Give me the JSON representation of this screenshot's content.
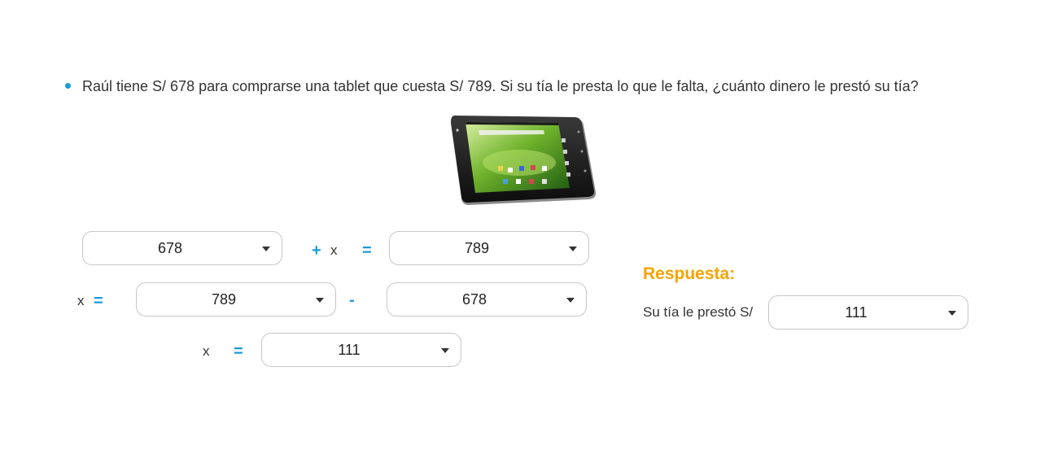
{
  "question": {
    "text": "Raúl tiene S/ 678 para comprarse una tablet que cuesta S/ 789. Si su tía le presta lo que le falta, ¿cuánto dinero le prestó su tía?"
  },
  "image": {
    "icon": "tablet-image"
  },
  "equations": {
    "row1": {
      "select1": "678",
      "plus": "+",
      "x": "x",
      "equals": "=",
      "select2": "789"
    },
    "row2": {
      "x": "x",
      "equals": "=",
      "select1": "789",
      "minus": "-",
      "select2": "678"
    },
    "row3": {
      "x": "x",
      "equals": "=",
      "select1": "111"
    }
  },
  "answer": {
    "title": "Respuesta:",
    "label": "Su tía le prestó S/",
    "select": "111"
  },
  "colors": {
    "accent": "#1a9bd7",
    "answer_title": "#f5a400",
    "border": "#c7c7c7"
  }
}
